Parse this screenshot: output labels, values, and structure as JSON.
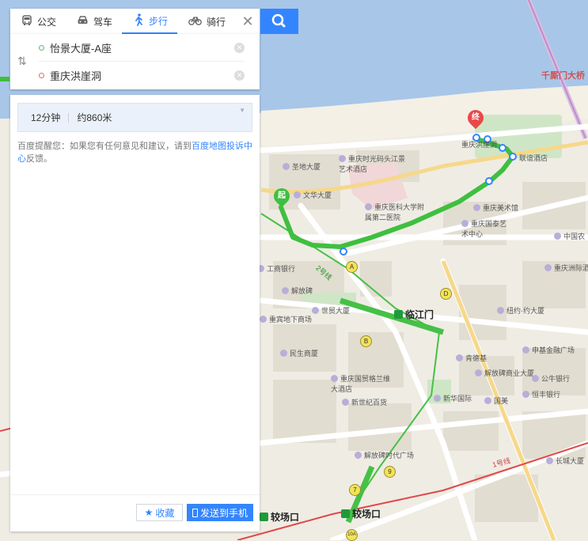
{
  "tabs": [
    {
      "label": "公交",
      "icon": "bus-icon"
    },
    {
      "label": "驾车",
      "icon": "car-icon"
    },
    {
      "label": "步行",
      "icon": "walk-icon"
    },
    {
      "label": "骑行",
      "icon": "bike-icon"
    }
  ],
  "active_tab": "步行",
  "route": {
    "start": "怡景大厦-A座",
    "end": "重庆洪崖洞"
  },
  "summary": {
    "duration": "12分钟",
    "distance": "约860米"
  },
  "notice": {
    "text_before": "百度提醒您：如果您有任何意见和建议，请到",
    "link": "百度地图投诉中心",
    "text_after": "反馈。"
  },
  "buttons": {
    "favorite": "收藏",
    "send_to_phone": "发送到手机"
  },
  "map": {
    "start_marker": "起",
    "end_marker": "终",
    "labels": {
      "bridge": "千厮门大桥",
      "hongyadong": "重庆洪崖洞",
      "shitang": "重庆时光码头江景艺术酒店",
      "chengdi": "圣地大厦",
      "wenhua": "文华大厦",
      "hospital": "重庆医科大学附属第二医院",
      "meishu": "重庆美术馆",
      "guotai": "重庆国泰艺术中心",
      "gongshang": "工商银行",
      "zhenrong": "解放碑",
      "shimao": "世贸大厦",
      "binde": "重宾地下商场",
      "minsheng": "民生商厦",
      "niuyue": "纽约·约大厦",
      "kendeji": "肯德基",
      "jiefangbei": "解放碑商业大厦",
      "shenjin": "申基金融广场",
      "guomao": "重庆国贸格兰维大酒店",
      "xinshiji": "新世纪百货",
      "xinhua": "新华国际",
      "guomei": "国美",
      "hengfeng": "恒丰银行",
      "jiefang_mall": "解放碑时代广场",
      "changcheng": "长城大厦",
      "zhongguo": "中国农",
      "yizhou": "重庆洲际酒店",
      "gongji": "公牛银行",
      "linjiangmen": "临江门",
      "jiaochangkou": "较场口",
      "jiaochangkou2": "较场口",
      "line1": "1号线",
      "line2": "2号线",
      "lianyi": "联谊酒店"
    },
    "exits": [
      "A",
      "B",
      "D",
      "7",
      "9",
      "10A"
    ]
  },
  "colors": {
    "accent": "#3385ff",
    "route": "#3fbf3f",
    "water": "#a8c6e8"
  }
}
